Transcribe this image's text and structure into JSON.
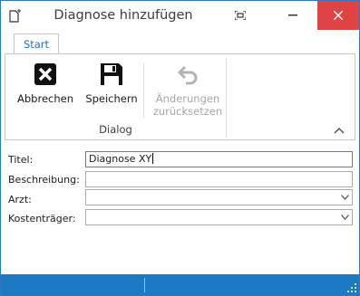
{
  "window": {
    "title": "Diagnose hinzufügen"
  },
  "ribbon": {
    "tabs": [
      {
        "label": "Start"
      }
    ],
    "group_label": "Dialog",
    "buttons": {
      "cancel": {
        "label": "Abbrechen",
        "icon": "close-x-icon"
      },
      "save": {
        "label": "Speichern",
        "icon": "floppy-disk-icon"
      },
      "reset": {
        "label_line1": "Änderungen",
        "label_line2": "zurücksetzen",
        "icon": "undo-arrow-icon",
        "enabled": false
      }
    }
  },
  "form": {
    "title": {
      "label": "Titel:",
      "value": "Diagnose XY"
    },
    "description": {
      "label": "Beschreibung:",
      "value": ""
    },
    "doctor": {
      "label": "Arzt:",
      "value": ""
    },
    "cost_bearer": {
      "label": "Kostenträger:",
      "value": ""
    }
  },
  "colors": {
    "accent": "#1e79c3",
    "close_button": "#e04343",
    "tab_text": "#1f6fbf",
    "disabled_text": "#a6a6a6"
  }
}
